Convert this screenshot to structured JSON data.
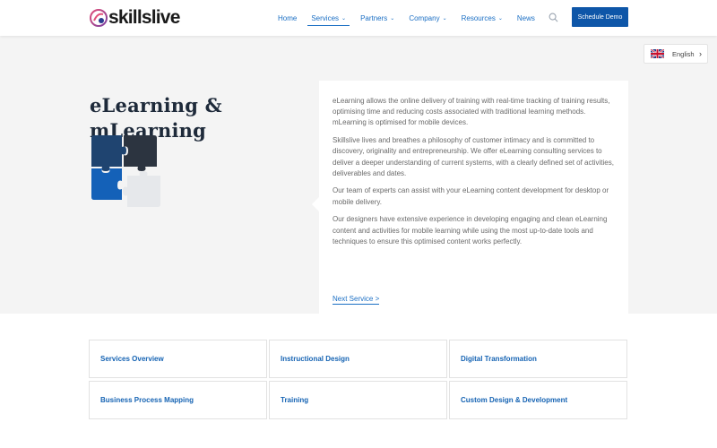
{
  "header": {
    "brand": "skillslive",
    "nav": [
      {
        "label": "Home",
        "dropdown": false,
        "active": false
      },
      {
        "label": "Services",
        "dropdown": true,
        "active": true
      },
      {
        "label": "Partners",
        "dropdown": true,
        "active": false
      },
      {
        "label": "Company",
        "dropdown": true,
        "active": false
      },
      {
        "label": "Resources",
        "dropdown": true,
        "active": false
      },
      {
        "label": "News",
        "dropdown": false,
        "active": false
      }
    ],
    "search_icon": "search-icon",
    "cta_label": "Schedule Demo"
  },
  "hero": {
    "title_line1": "eLearning &",
    "title_line2": "mLearning",
    "paragraphs": [
      "eLearning allows the online delivery of training with real-time tracking of training results, optimising time and reducing costs associated with traditional learning methods. mLearning is optimised for mobile devices.",
      "Skillslive lives and breathes a philosophy of customer intimacy and is committed to discovery, originality and entrepreneurship. We offer eLearning consulting services to deliver a deeper understanding of current systems, with a clearly defined set of activities, deliverables and dates.",
      "Our team of experts can assist with your eLearning content development for desktop or mobile delivery.",
      "Our designers have extensive experience in developing engaging and clean eLearning content and activities for mobile learning while using the most up-to-date tools and techniques to ensure this optimised content works perfectly."
    ],
    "next_link": "Next Service >"
  },
  "language": {
    "label": "English",
    "flag_icon": "uk-flag-icon"
  },
  "services": [
    "Services Overview",
    "Instructional Design",
    "Digital Transformation",
    "Business Process Mapping",
    "Training",
    "Custom Design & Development"
  ],
  "colors": {
    "accent": "#1b6fc4",
    "button": "#0e56a8",
    "hero_bg": "#f4f4f4",
    "title": "#1e2a3a"
  }
}
